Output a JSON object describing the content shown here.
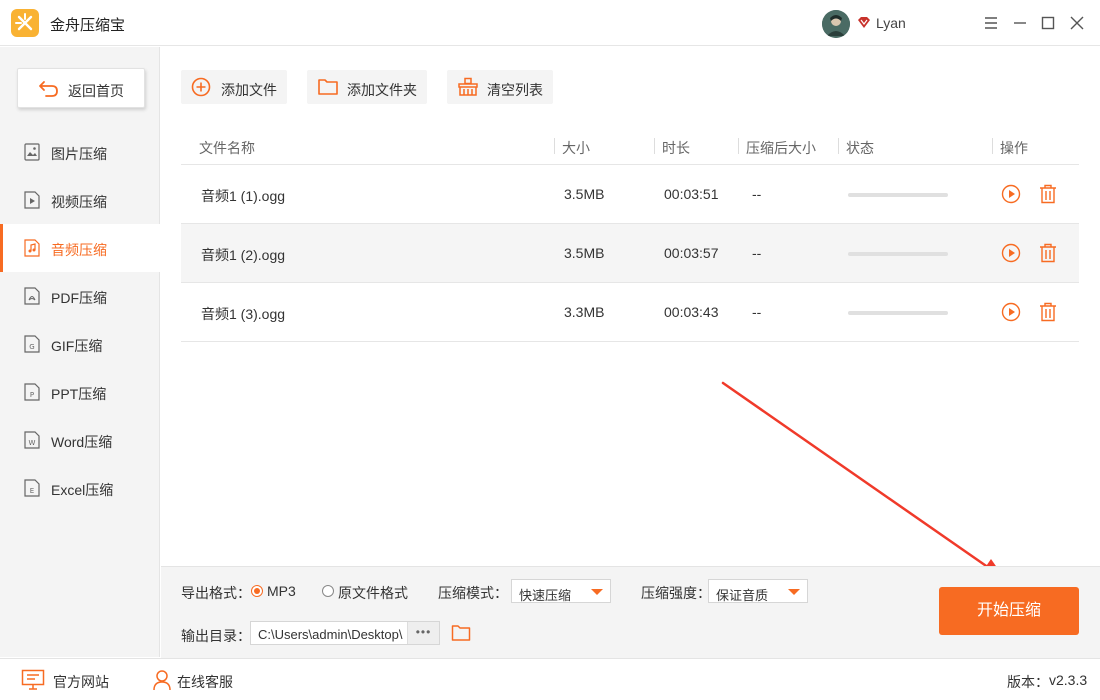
{
  "app": {
    "title": "金舟压缩宝",
    "user": "Lyan",
    "colors": {
      "accent": "#f76b22",
      "logo": "#f9b233",
      "annotation": "#f03a2a"
    }
  },
  "window_controls": [
    "menu-icon",
    "minimize-icon",
    "maximize-icon",
    "close-icon"
  ],
  "sidebar": {
    "back_label": "返回首页",
    "items": [
      {
        "label": "图片压缩",
        "icon": "image-file-icon",
        "active": false
      },
      {
        "label": "视频压缩",
        "icon": "video-file-icon",
        "active": false
      },
      {
        "label": "音频压缩",
        "icon": "audio-file-icon",
        "active": true
      },
      {
        "label": "PDF压缩",
        "icon": "pdf-file-icon",
        "active": false
      },
      {
        "label": "GIF压缩",
        "icon": "gif-file-icon",
        "active": false
      },
      {
        "label": "PPT压缩",
        "icon": "ppt-file-icon",
        "active": false
      },
      {
        "label": "Word压缩",
        "icon": "word-file-icon",
        "active": false
      },
      {
        "label": "Excel压缩",
        "icon": "excel-file-icon",
        "active": false
      }
    ]
  },
  "toolbar": {
    "add_file": "添加文件",
    "add_folder": "添加文件夹",
    "clear_list": "清空列表"
  },
  "table": {
    "headers": {
      "name": "文件名称",
      "size": "大小",
      "duration": "时长",
      "compressed_size": "压缩后大小",
      "status": "状态",
      "actions": "操作"
    },
    "rows": [
      {
        "name": "音频1 (1).ogg",
        "size": "3.5MB",
        "duration": "00:03:51",
        "compressed_size": "--",
        "progress": 0
      },
      {
        "name": "音频1 (2).ogg",
        "size": "3.5MB",
        "duration": "00:03:57",
        "compressed_size": "--",
        "progress": 0
      },
      {
        "name": "音频1 (3).ogg",
        "size": "3.3MB",
        "duration": "00:03:43",
        "compressed_size": "--",
        "progress": 0
      }
    ]
  },
  "options": {
    "format_label": "导出格式：",
    "format_mp3": "MP3",
    "format_original": "原文件格式",
    "format_selected": "MP3",
    "mode_label": "压缩模式：",
    "mode_value": "快速压缩",
    "strength_label": "压缩强度：",
    "strength_value": "保证音质",
    "output_label": "输出目录：",
    "output_path": "C:\\Users\\admin\\Desktop\\",
    "browse_label": "•••"
  },
  "start_button": "开始压缩",
  "statusbar": {
    "website": "官方网站",
    "support": "在线客服",
    "version_label": "版本：",
    "version": "v2.3.3"
  }
}
